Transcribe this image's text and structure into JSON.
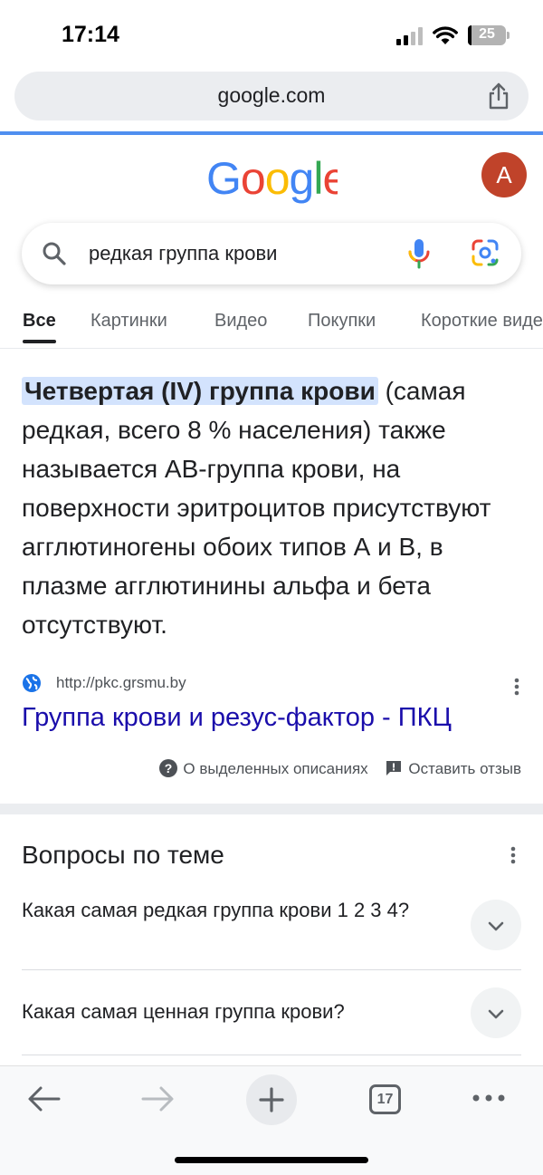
{
  "status_bar": {
    "time": "17:14",
    "battery": "25"
  },
  "browser": {
    "url": "google.com"
  },
  "google": {
    "avatar_letter": "A"
  },
  "search": {
    "query": "редкая группа крови"
  },
  "tabs": [
    {
      "label": "Все"
    },
    {
      "label": "Картинки"
    },
    {
      "label": "Видео"
    },
    {
      "label": "Покупки"
    },
    {
      "label": "Короткие видео"
    }
  ],
  "snippet": {
    "highlight": "Четвертая (IV) группа крови",
    "text": " (самая редкая, всего 8 % населения) также называется АВ-группа крови, на поверхности эритроцитов присутствуют агглютиногены обоих типов А и В, в плазме агглютинины альфа и бета отсутствуют."
  },
  "result": {
    "source_url": "http://pkc.grsmu.by",
    "title": "Группа крови и резус-фактор - ПКЦ"
  },
  "featured_footer": {
    "about_label": "О выделенных описаниях",
    "feedback_label": "Оставить отзыв"
  },
  "related": {
    "title": "Вопросы по теме",
    "questions": [
      {
        "text": "Какая самая редкая группа крови 1 2 3 4?"
      },
      {
        "text": "Какая самая ценная группа крови?"
      }
    ]
  },
  "toolbar": {
    "tab_count": "17"
  },
  "colors": {
    "link": "#1a0dab",
    "highlight": "#d3e3fd",
    "avatar": "#c0432a",
    "progress": "#4f8ff0"
  }
}
